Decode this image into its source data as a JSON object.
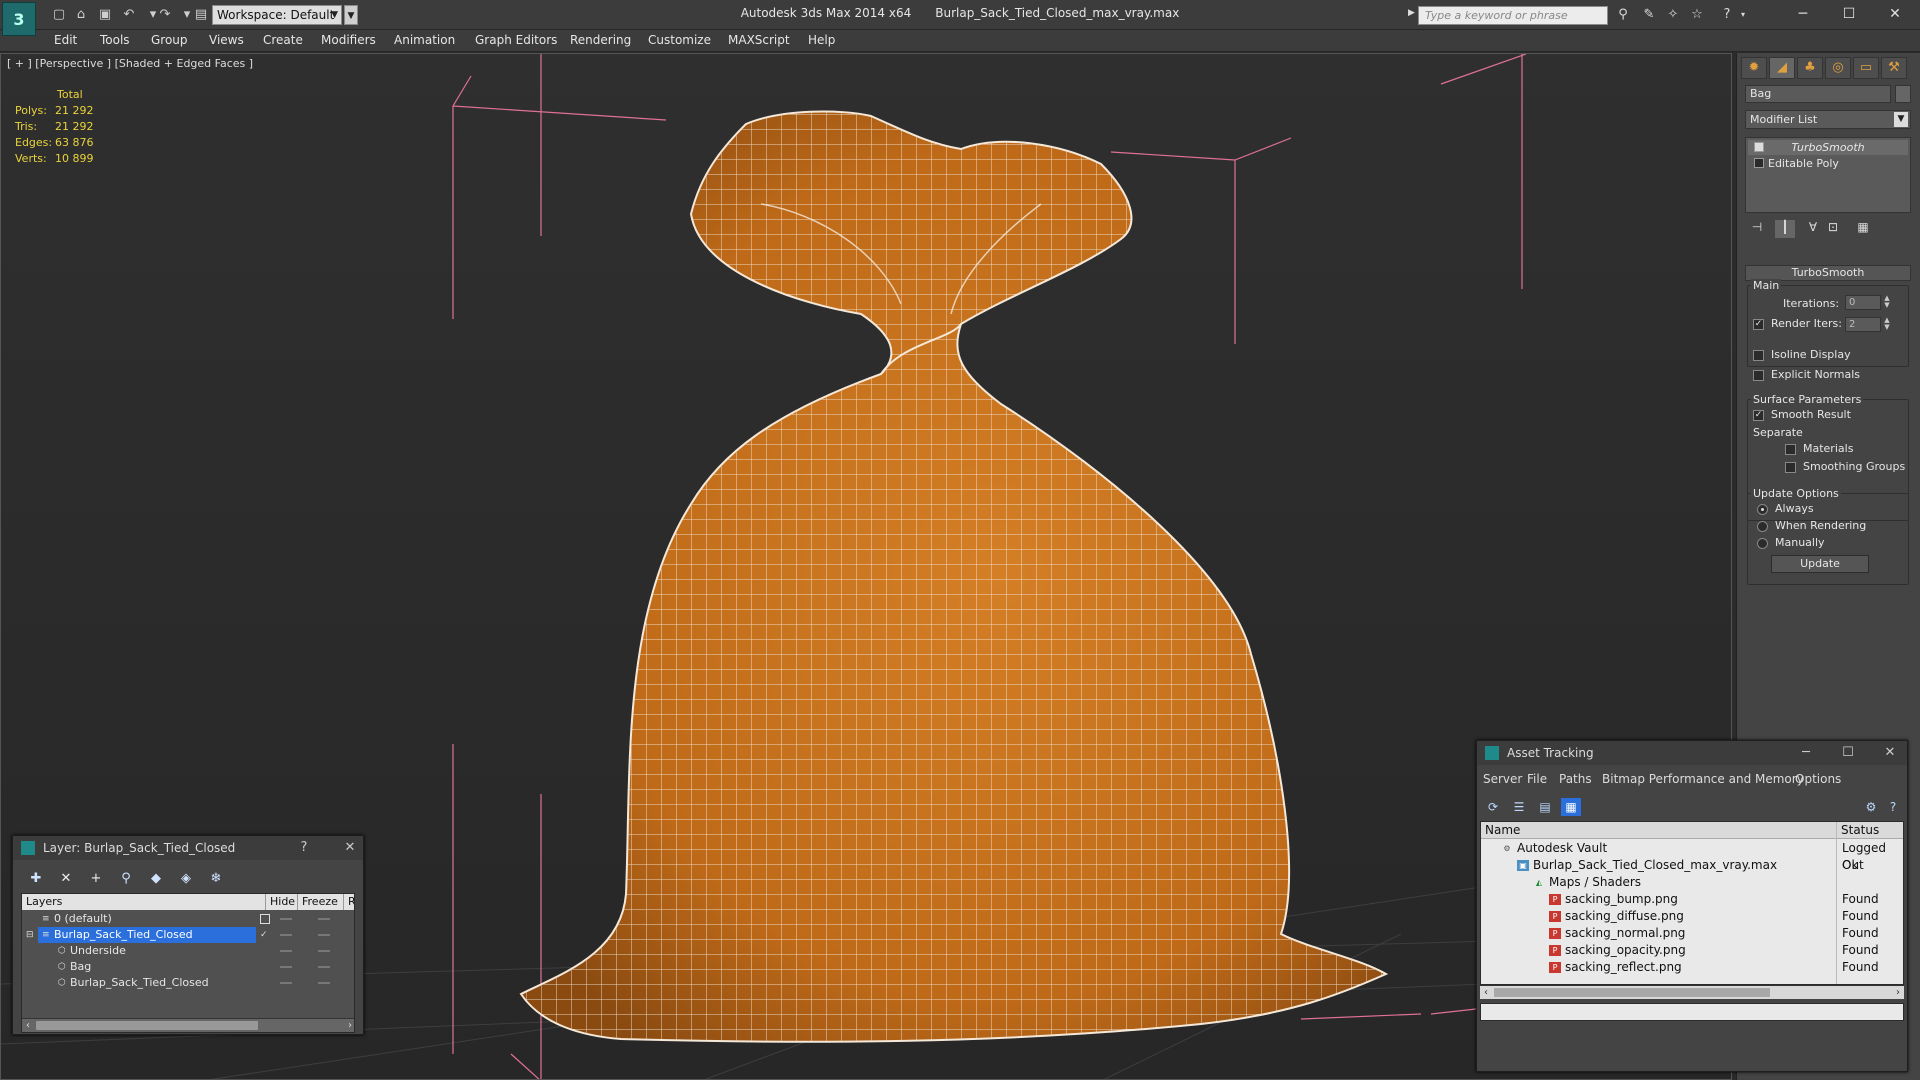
{
  "titlebar": {
    "app_logo": "3",
    "workspace": "Workspace: Default",
    "app_title": "Autodesk 3ds Max  2014 x64",
    "file_name": "Burlap_Sack_Tied_Closed_max_vray.max",
    "search_placeholder": "Type a keyword or phrase",
    "minimize": "─",
    "maximize": "☐",
    "close": "✕"
  },
  "menu": [
    "Edit",
    "Tools",
    "Group",
    "Views",
    "Create",
    "Modifiers",
    "Animation",
    "Graph Editors",
    "Rendering",
    "Customize",
    "MAXScript",
    "Help"
  ],
  "viewport": {
    "label": "[ + ] [Perspective ] [Shaded + Edged Faces ]",
    "stats": {
      "header": "Total",
      "rows": [
        {
          "label": "Polys:",
          "value": "21 292"
        },
        {
          "label": "Tris:",
          "value": "21 292"
        },
        {
          "label": "Edges:",
          "value": "63 876"
        },
        {
          "label": "Verts:",
          "value": "10 899"
        }
      ]
    }
  },
  "command_panel": {
    "object_name": "Bag",
    "modifier_list": "Modifier List",
    "stack": [
      "TurboSmooth",
      "Editable Poly"
    ],
    "rollout_title": "TurboSmooth",
    "main_group": "Main",
    "iterations_label": "Iterations:",
    "iterations_value": "0",
    "render_iters_label": "Render Iters:",
    "render_iters_value": "2",
    "isoline_label": "Isoline Display",
    "explicit_normals_label": "Explicit Normals",
    "surface_group": "Surface Parameters",
    "smooth_result_label": "Smooth Result",
    "separate_label": "Separate",
    "materials_label": "Materials",
    "smoothing_groups_label": "Smoothing Groups",
    "update_group": "Update Options",
    "always_label": "Always",
    "when_rendering_label": "When Rendering",
    "manually_label": "Manually",
    "update_button": "Update"
  },
  "layer_window": {
    "title": "Layer: Burlap_Sack_Tied_Closed",
    "help": "?",
    "close": "✕",
    "columns": [
      "Layers",
      "Hide",
      "Freeze",
      "R"
    ],
    "rows": [
      {
        "name": "0 (default)"
      },
      {
        "name": "Burlap_Sack_Tied_Closed"
      },
      {
        "name": "Underside"
      },
      {
        "name": "Bag"
      },
      {
        "name": "Burlap_Sack_Tied_Closed"
      }
    ]
  },
  "asset_window": {
    "title": "Asset Tracking",
    "menu": [
      "Server",
      "File",
      "Paths",
      "Bitmap Performance and Memory",
      "Options"
    ],
    "columns": [
      "Name",
      "Status"
    ],
    "rows": [
      {
        "name": "Autodesk Vault",
        "status": "Logged Out"
      },
      {
        "name": "Burlap_Sack_Tied_Closed_max_vray.max",
        "status": "Ok"
      },
      {
        "name": "Maps / Shaders",
        "status": ""
      },
      {
        "name": "sacking_bump.png",
        "status": "Found"
      },
      {
        "name": "sacking_diffuse.png",
        "status": "Found"
      },
      {
        "name": "sacking_normal.png",
        "status": "Found"
      },
      {
        "name": "sacking_opacity.png",
        "status": "Found"
      },
      {
        "name": "sacking_reflect.png",
        "status": "Found"
      }
    ]
  },
  "colors": {
    "stats": "#e9d33a",
    "bag": "#c8731e",
    "bounding_box": "#e0709a",
    "selection": "#2a6fdb"
  }
}
